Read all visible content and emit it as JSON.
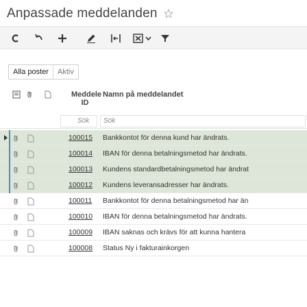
{
  "page": {
    "title": "Anpassade meddelanden"
  },
  "toolbar": {
    "icons": [
      "copy-icon",
      "undo-icon",
      "add-icon",
      "edit-icon",
      "grid-sum-icon",
      "excel-export-icon",
      "filter-icon"
    ]
  },
  "tabs": [
    {
      "label": "Alla poster",
      "active": true
    },
    {
      "label": "Aktiv",
      "active": false
    }
  ],
  "columns": {
    "id_title_line1": "Meddele",
    "id_title_line2": "ID",
    "name_title": "Namn på meddelandet"
  },
  "filter": {
    "id_placeholder": "Sök",
    "name_placeholder": "Sök"
  },
  "rows": [
    {
      "id": "100015",
      "name": "Bankkontot för denna kund har ändrats.",
      "selected": true
    },
    {
      "id": "100014",
      "name": "IBAN för denna betalningsmetod har ändrats.",
      "selected": true
    },
    {
      "id": "100013",
      "name": "Kundens standardbetalningsmetod har ändrat",
      "selected": true
    },
    {
      "id": "100012",
      "name": "Kundens leveransadresser har ändrats.",
      "selected": true
    },
    {
      "id": "100011",
      "name": "Bankkontot för denna betalningsmetod har än",
      "selected": false
    },
    {
      "id": "100010",
      "name": "IBAN för denna betalningsmetod har ändrats.",
      "selected": false
    },
    {
      "id": "100009",
      "name": "IBAN saknas och krävs för att kunna hantera",
      "selected": false
    },
    {
      "id": "100008",
      "name": "Status Ny i fakturainkorgen",
      "selected": false
    }
  ],
  "colors": {
    "selected_row": "#dde6d9",
    "selection_bar": "#4a8bc9",
    "toolbar_bg": "#f4f4f4"
  }
}
